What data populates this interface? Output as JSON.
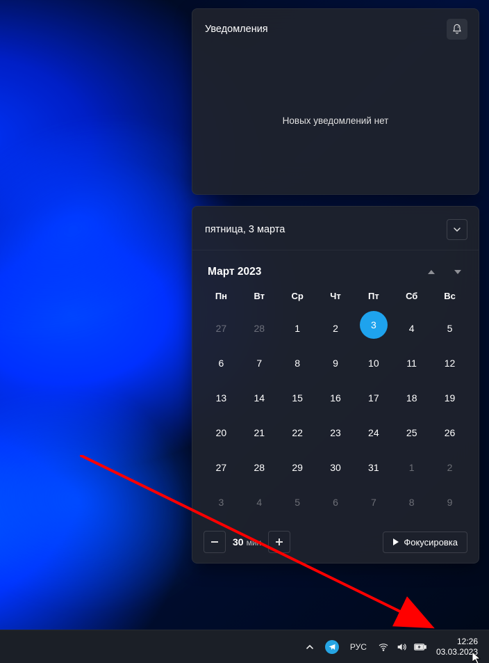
{
  "notifications": {
    "title": "Уведомления",
    "empty_text": "Новых уведомлений нет"
  },
  "calendar": {
    "current_date_label": "пятница, 3 марта",
    "month_label": "Март 2023",
    "weekdays": [
      "Пн",
      "Вт",
      "Ср",
      "Чт",
      "Пт",
      "Сб",
      "Вс"
    ],
    "days": [
      {
        "n": "27",
        "mute": true
      },
      {
        "n": "28",
        "mute": true
      },
      {
        "n": "1"
      },
      {
        "n": "2"
      },
      {
        "n": "3",
        "today": true
      },
      {
        "n": "4"
      },
      {
        "n": "5"
      },
      {
        "n": "6"
      },
      {
        "n": "7"
      },
      {
        "n": "8"
      },
      {
        "n": "9"
      },
      {
        "n": "10"
      },
      {
        "n": "11"
      },
      {
        "n": "12"
      },
      {
        "n": "13"
      },
      {
        "n": "14"
      },
      {
        "n": "15"
      },
      {
        "n": "16"
      },
      {
        "n": "17"
      },
      {
        "n": "18"
      },
      {
        "n": "19"
      },
      {
        "n": "20"
      },
      {
        "n": "21"
      },
      {
        "n": "22"
      },
      {
        "n": "23"
      },
      {
        "n": "24"
      },
      {
        "n": "25"
      },
      {
        "n": "26"
      },
      {
        "n": "27"
      },
      {
        "n": "28"
      },
      {
        "n": "29"
      },
      {
        "n": "30"
      },
      {
        "n": "31"
      },
      {
        "n": "1",
        "mute": true
      },
      {
        "n": "2",
        "mute": true
      },
      {
        "n": "3",
        "mute": true
      },
      {
        "n": "4",
        "mute": true
      },
      {
        "n": "5",
        "mute": true
      },
      {
        "n": "6",
        "mute": true
      },
      {
        "n": "7",
        "mute": true
      },
      {
        "n": "8",
        "mute": true
      },
      {
        "n": "9",
        "mute": true
      }
    ],
    "focus_minutes": "30",
    "focus_unit": "мин",
    "focus_button": "Фокусировка"
  },
  "taskbar": {
    "language": "РУС",
    "time": "12:26",
    "date": "03.03.2023"
  },
  "colors": {
    "accent": "#1ea3ee",
    "panel_bg": "#1e232d",
    "taskbar_bg": "#1b1f27"
  }
}
